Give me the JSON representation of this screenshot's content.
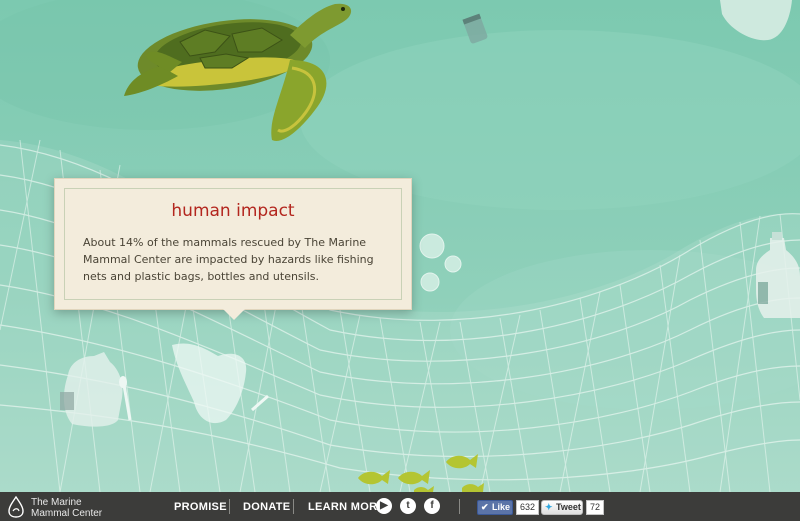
{
  "popup": {
    "title": "human impact",
    "body": "About 14% of the mammals rescued by The Marine Mammal Center are impacted by hazards like fishing nets and plastic bags, bottles and utensils."
  },
  "footer": {
    "logo_line1": "The Marine",
    "logo_line2": "Mammal Center",
    "nav": [
      "PROMISE",
      "DONATE",
      "LEARN MORE"
    ],
    "social_icons": [
      "youtube-icon",
      "twitter-icon",
      "facebook-icon"
    ],
    "like_label": "Like",
    "like_count": "632",
    "tweet_label": "Tweet",
    "tweet_count": "72"
  },
  "colors": {
    "water": "#87cdb6",
    "popup_bg": "#f3ecdc",
    "popup_title": "#b3261e",
    "footer_bg": "#3c3c3a"
  }
}
